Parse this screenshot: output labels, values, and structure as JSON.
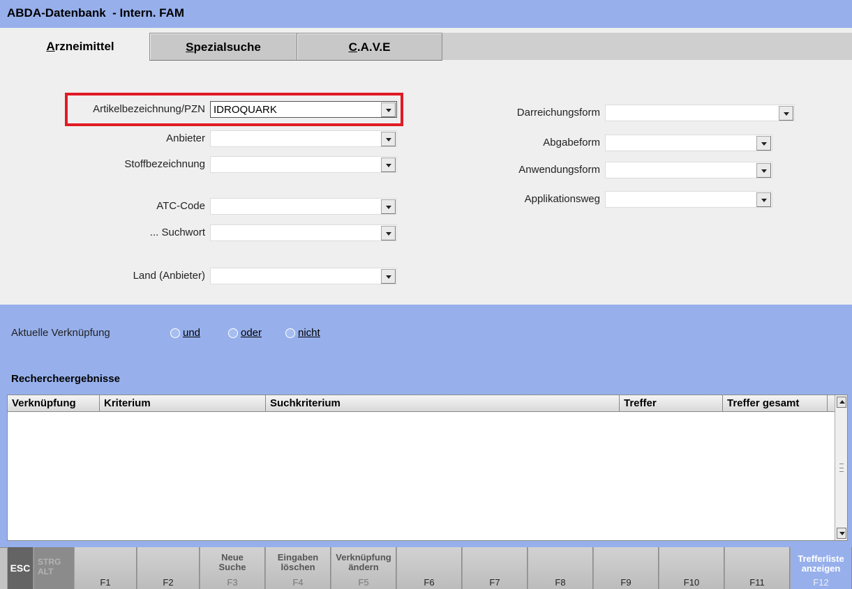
{
  "window": {
    "title": "ABDA-Datenbank  - Intern. FAM"
  },
  "tabs": [
    {
      "first": "A",
      "rest": "rzneimittel"
    },
    {
      "first": "S",
      "rest": "pezialsuche"
    },
    {
      "first": "C",
      "rest": ".A.V.E"
    }
  ],
  "form_left": {
    "artikel": {
      "label": "Artikelbezeichnung/PZN",
      "value": "IDROQUARK"
    },
    "anbieter": {
      "label": "Anbieter",
      "value": ""
    },
    "stoff": {
      "label": "Stoffbezeichnung",
      "value": ""
    },
    "atc": {
      "label": "ATC-Code",
      "value": ""
    },
    "suchwort": {
      "label": "... Suchwort",
      "value": ""
    },
    "land": {
      "label": "Land (Anbieter)",
      "value": ""
    }
  },
  "form_right": {
    "darreichung": {
      "label": "Darreichungsform",
      "value": ""
    },
    "abgabe": {
      "label": "Abgabeform",
      "value": ""
    },
    "anwendung": {
      "label": "Anwendungsform",
      "value": ""
    },
    "applikation": {
      "label": "Applikationsweg",
      "value": ""
    }
  },
  "verknuepfung": {
    "label": "Aktuelle Verknüpfung",
    "options": [
      "und",
      "oder",
      "nicht"
    ]
  },
  "results": {
    "title": "Rechercheergebnisse",
    "columns": [
      "Verknüpfung",
      "Kriterium",
      "Suchkriterium",
      "Treffer",
      "Treffer gesamt"
    ],
    "rows": []
  },
  "fkeys": {
    "esc": "ESC",
    "strg": "STRG\nALT",
    "f1": {
      "label": "",
      "key": "F1"
    },
    "f2": {
      "label": "",
      "key": "F2"
    },
    "f3": {
      "label": "Neue\nSuche",
      "key": "F3"
    },
    "f4": {
      "label": "Eingaben\nlöschen",
      "key": "F4"
    },
    "f5": {
      "label": "Verknüpfung\nändern",
      "key": "F5"
    },
    "f6": {
      "label": "",
      "key": "F6"
    },
    "f7": {
      "label": "",
      "key": "F7"
    },
    "f8": {
      "label": "",
      "key": "F8"
    },
    "f9": {
      "label": "",
      "key": "F9"
    },
    "f10": {
      "label": "",
      "key": "F10"
    },
    "f11": {
      "label": "",
      "key": "F11"
    },
    "f12": {
      "label": "Trefferliste\nanzeigen",
      "key": "F12"
    }
  },
  "colors": {
    "accent_blue": "#97b0ec",
    "highlight_red": "#e01b24"
  }
}
